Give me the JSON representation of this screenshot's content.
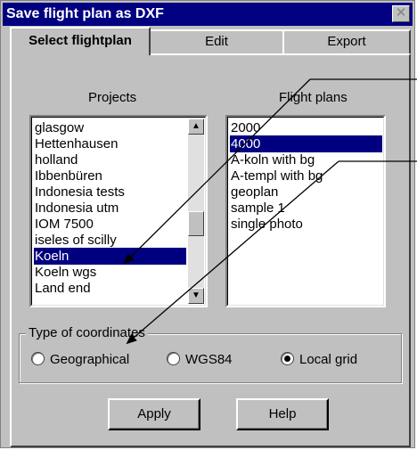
{
  "window": {
    "title": "Save flight plan as DXF"
  },
  "tabs": [
    {
      "label": "Select flightplan",
      "active": true
    },
    {
      "label": "Edit",
      "active": false
    },
    {
      "label": "Export",
      "active": false
    }
  ],
  "projects": {
    "label": "Projects",
    "items": [
      "glasgow",
      "Hettenhausen",
      "holland",
      "Ibbenbüren",
      "Indonesia tests",
      "Indonesia utm",
      "IOM 7500",
      "iseles of scilly",
      "Koeln",
      "Koeln wgs",
      "Land end"
    ],
    "selected": "Koeln"
  },
  "flightplans": {
    "label": "Flight plans",
    "items": [
      "2000",
      "4000",
      "A-koln with bg",
      "A-templ with bg",
      "geoplan",
      "sample 1",
      "single photo"
    ],
    "selected": "4000"
  },
  "coordinates": {
    "label": "Type of coordinates",
    "options": [
      "Geographical",
      "WGS84",
      "Local grid"
    ],
    "selected": "Local grid"
  },
  "buttons": {
    "apply": "Apply",
    "help": "Help"
  },
  "colors": {
    "selection": "#000080",
    "face": "#c0c0c0"
  }
}
